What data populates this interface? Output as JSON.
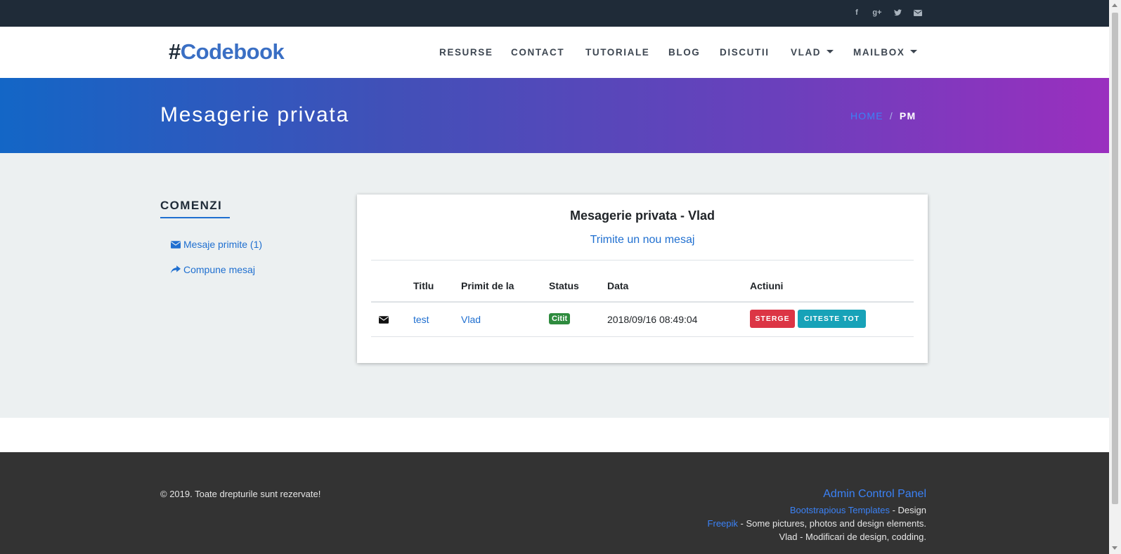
{
  "topbar": {
    "social": [
      {
        "icon": "facebook-icon",
        "glyph": "f"
      },
      {
        "icon": "google-plus-icon",
        "glyph": "g+"
      },
      {
        "icon": "twitter-icon",
        "glyph": "t"
      },
      {
        "icon": "envelope-icon",
        "glyph": "✉"
      }
    ]
  },
  "navbar": {
    "logo_hash": "#",
    "logo_text": "Codebook",
    "items": [
      "RESURSE",
      "CONTACT",
      "TUTORIALE",
      "BLOG",
      "DISCUTII",
      "VLAD",
      "MAILBOX"
    ]
  },
  "hero": {
    "title": "Mesagerie privata",
    "breadcrumb": {
      "home": "HOME",
      "separator": "/",
      "current": "PM"
    }
  },
  "sidebar": {
    "title": "COMENZI",
    "links": [
      {
        "label": "Mesaje primite (1)",
        "icon": "envelope-icon"
      },
      {
        "label": "Compune mesaj",
        "icon": "share-arrow-icon"
      }
    ]
  },
  "card": {
    "title": "Mesagerie privata - Vlad",
    "new_message_link": "Trimite un nou mesaj",
    "columns": [
      "Titlu",
      "Primit de la",
      "Status",
      "Data",
      "Actiuni"
    ],
    "rows": [
      {
        "icon": "envelope-icon",
        "title": "test",
        "from": "Vlad",
        "status": "Citit",
        "date": "2018/09/16 08:49:04",
        "actions": [
          "STERGE",
          "CITESTE TOT"
        ]
      }
    ]
  },
  "footer": {
    "copyright": "© 2019. Toate drepturile sunt rezervate!",
    "admin_link": "Admin Control Panel",
    "credits": [
      {
        "link": "Bootstrapious Templates",
        "text": " - Design"
      },
      {
        "link": "Freepik",
        "text": " - Some pictures, photos and design elements."
      },
      {
        "link": "",
        "text": "Vlad - Modificari de design, codding."
      }
    ]
  },
  "colors": {
    "topbar": "#1f2b38",
    "accent": "#1f6fd0",
    "danger": "#dc3545",
    "info": "#17a2b8",
    "success": "#2e8b3e",
    "footer": "#333333"
  }
}
